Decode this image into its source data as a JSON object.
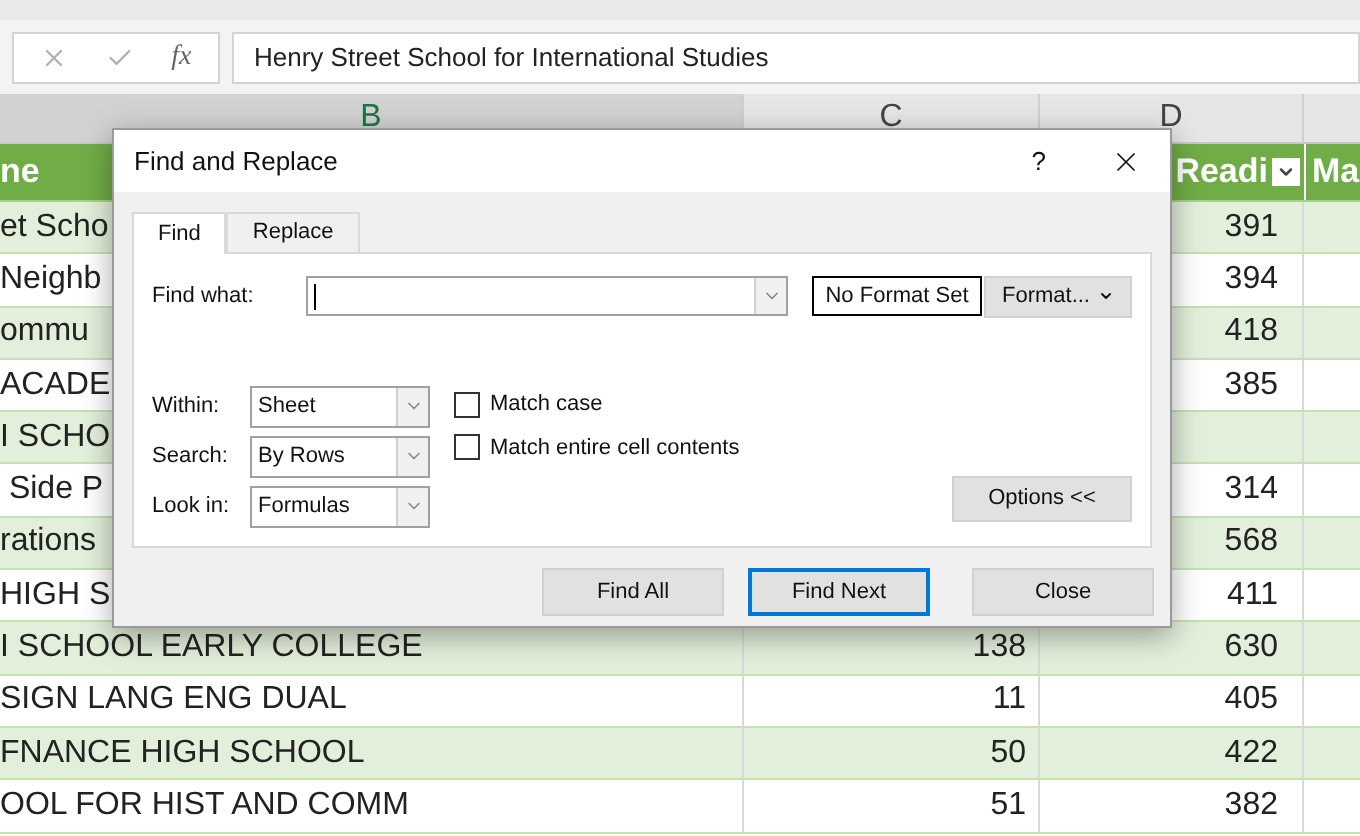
{
  "formula_bar": {
    "function_label": "fx",
    "value": "Henry Street School for International Studies"
  },
  "columns": [
    {
      "label": "B",
      "selected": true
    },
    {
      "label": "C",
      "selected": false
    },
    {
      "label": "D",
      "selected": false
    }
  ],
  "header_row": {
    "column_b": "ne",
    "column_d": "Readi",
    "column_e": "Ma"
  },
  "rows": [
    {
      "column_b": "et Scho",
      "column_d": "391"
    },
    {
      "column_b": "Neighb",
      "column_d": "394"
    },
    {
      "column_b": "ommu",
      "column_d": "418"
    },
    {
      "column_b": "ACADE",
      "column_d": "385"
    },
    {
      "column_b": "I SCHO"
    },
    {
      "column_b": " Side P",
      "column_d": "314"
    },
    {
      "column_b": "rations",
      "column_d": "568"
    },
    {
      "column_b": "HIGH S",
      "column_d": "411"
    },
    {
      "column_b": "I SCHOOL EARLY COLLEGE",
      "column_c": "138",
      "column_d": "630"
    },
    {
      "column_b": "SIGN LANG ENG DUAL",
      "column_c": "11",
      "column_d": "405"
    },
    {
      "column_b": "FNANCE HIGH SCHOOL",
      "column_c": "50",
      "column_d": "422"
    },
    {
      "column_b": "OOL FOR HIST AND COMM",
      "column_c": "51",
      "column_d": "382"
    }
  ],
  "dialog": {
    "title": "Find and Replace",
    "help": "?",
    "tabs": [
      {
        "label": "Find",
        "selected": true
      },
      {
        "label": "Replace",
        "selected": false
      }
    ],
    "find_what": {
      "label": "Find what:"
    },
    "format_status": "No Format Set",
    "format_button": {
      "label": "Format..."
    },
    "selects": [
      {
        "label": "Within:",
        "value": "Sheet"
      },
      {
        "label": "Search:",
        "value": "By Rows"
      },
      {
        "label": "Look in:",
        "value": "Formulas"
      }
    ],
    "checkboxes": [
      {
        "label": "Match case",
        "checked": false
      },
      {
        "label": "Match entire cell contents",
        "checked": false
      }
    ],
    "options_button": {
      "label": "Options <<"
    },
    "buttons": [
      {
        "label": "Find All",
        "default": false
      },
      {
        "label": "Find Next",
        "default": true
      },
      {
        "label": "Close",
        "default": false
      }
    ]
  }
}
